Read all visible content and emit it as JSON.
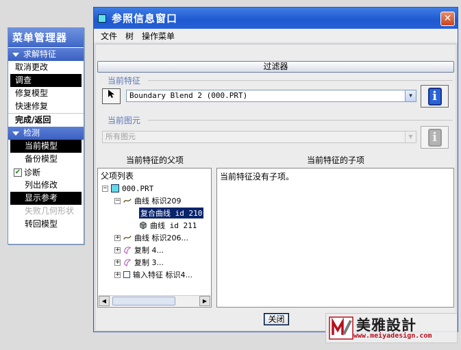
{
  "menu_manager": {
    "title": "菜单管理器",
    "sections": [
      {
        "label": "求解特征"
      },
      {
        "label": "检测"
      }
    ],
    "items_group1": [
      "取消更改",
      "调查",
      "修复模型",
      "快速修复",
      "完成/返回"
    ],
    "items_group2": [
      "当前模型",
      "备份模型"
    ],
    "diagnose_label": "诊断",
    "items_group3": [
      "列出修改",
      "显示参考",
      "失败几何形状",
      "转回模型"
    ]
  },
  "dialog": {
    "title": "参照信息窗口",
    "menus": [
      "文件",
      "树",
      "操作菜单"
    ],
    "filter_button": "过滤器",
    "current_feature_label": "当前特征",
    "current_feature_value": "Boundary Blend 2 (000.PRT)",
    "current_element_label": "当前图元",
    "current_element_value": "所有图元",
    "parents_header": "当前特征的父项",
    "children_header": "当前特征的子项",
    "parent_list_title": "父项列表",
    "tree": {
      "root": "000.PRT",
      "curve1": "曲线 标识209",
      "composite_curve": "复合曲线 id 210",
      "curve_id": "曲线 id 211",
      "curve2": "曲线 标识206...",
      "copy1": "复制 4...",
      "copy2": "复制 3...",
      "import": "输入特征 标识4..."
    },
    "children_text": "当前特征没有子项。",
    "close_button": "关闭"
  },
  "watermark": {
    "name": "美雅設計",
    "url": "www.meiyadesign.com"
  }
}
